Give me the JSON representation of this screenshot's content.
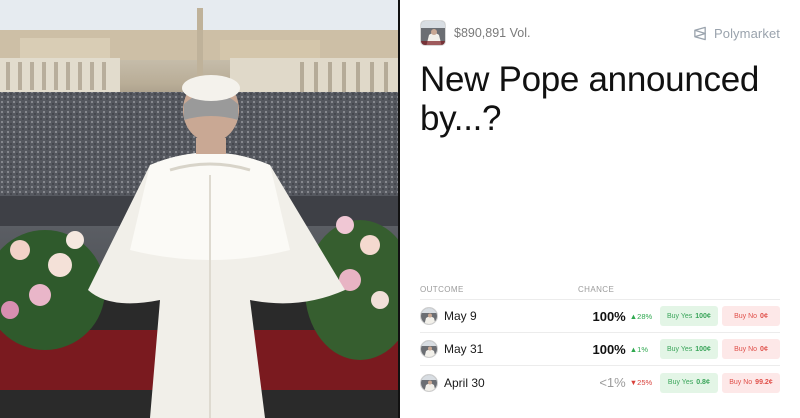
{
  "market": {
    "volume": "$890,891 Vol.",
    "brand": "Polymarket",
    "title": "New Pope announced by...?"
  },
  "table": {
    "header_outcome": "OUTCOME",
    "header_chance": "CHANCE",
    "rows": [
      {
        "label": "May 9",
        "chance": "100%",
        "delta": "▲28%",
        "buy_yes_label": "Buy Yes",
        "buy_yes_price": "100¢",
        "buy_no_label": "Buy No",
        "buy_no_price": "0¢"
      },
      {
        "label": "May 31",
        "chance": "100%",
        "delta": "▲1%",
        "buy_yes_label": "Buy Yes",
        "buy_yes_price": "100¢",
        "buy_no_label": "Buy No",
        "buy_no_price": "0¢"
      },
      {
        "label": "April 30",
        "chance": "<1%",
        "delta": "▼25%",
        "buy_yes_label": "Buy Yes",
        "buy_yes_price": "0.8¢",
        "buy_no_label": "Buy No",
        "buy_no_price": "99.2¢"
      }
    ]
  },
  "colors": {
    "yes_bg": "#e3f5e6",
    "yes_text": "#3aa55a",
    "no_bg": "#fde8e8",
    "no_text": "#e0504a",
    "up": "#2fa84f",
    "down": "#d9413b"
  },
  "icons": {
    "brand": "polymarket-logo-icon"
  }
}
